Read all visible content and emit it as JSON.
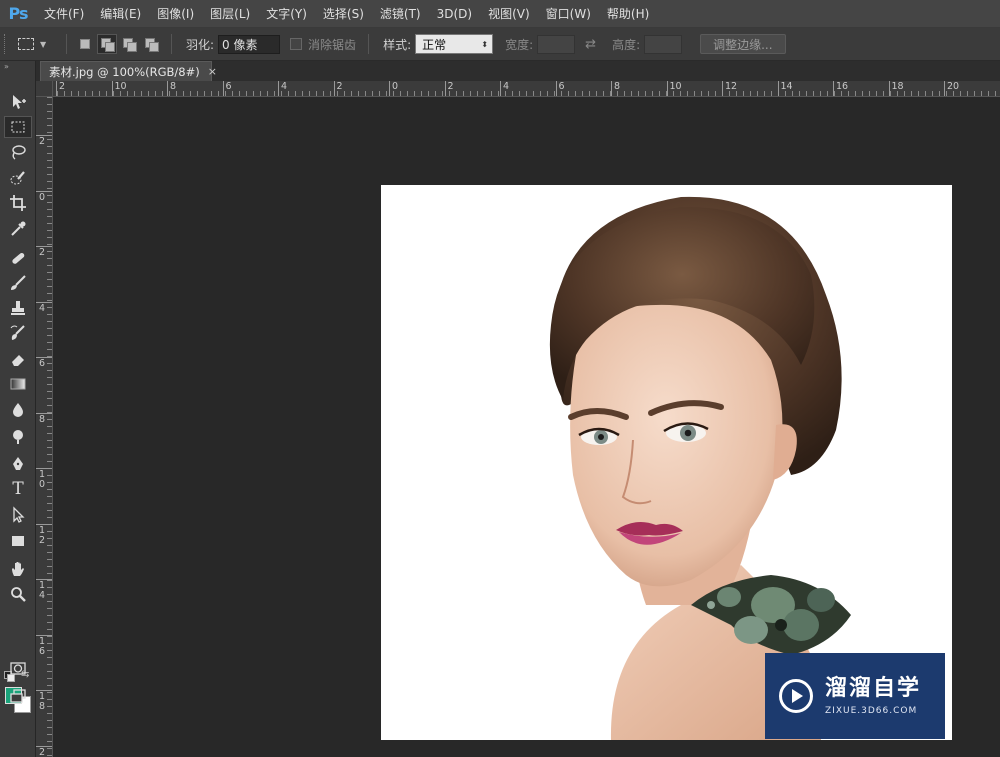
{
  "app": {
    "logo": "Ps"
  },
  "menu": [
    "文件(F)",
    "编辑(E)",
    "图像(I)",
    "图层(L)",
    "文字(Y)",
    "选择(S)",
    "滤镜(T)",
    "3D(D)",
    "视图(V)",
    "窗口(W)",
    "帮助(H)"
  ],
  "options": {
    "feather_label": "羽化:",
    "feather_value": "0 像素",
    "antialias_label": "消除锯齿",
    "style_label": "样式:",
    "style_value": "正常",
    "width_label": "宽度:",
    "height_label": "高度:",
    "refine_edge": "调整边缘..."
  },
  "document": {
    "tab_title": "素材.jpg @ 100%(RGB/8#)",
    "close": "×"
  },
  "ruler_h": [
    "2",
    "10",
    "8",
    "6",
    "4",
    "2",
    "0",
    "2",
    "4",
    "6",
    "8",
    "10",
    "12",
    "14",
    "16",
    "18",
    "20",
    "2"
  ],
  "ruler_v": [
    "2",
    "0",
    "2",
    "4",
    "6",
    "8",
    "1\n0",
    "1\n2",
    "1\n4",
    "1\n6",
    "1\n8",
    "2"
  ],
  "toolbar": {
    "collapse": "»",
    "tools": [
      "move-tool",
      "rect-marquee-tool",
      "lasso-tool",
      "quick-select-tool",
      "crop-tool",
      "eyedropper-tool",
      "healing-brush-tool",
      "brush-tool",
      "clone-stamp-tool",
      "history-brush-tool",
      "eraser-tool",
      "gradient-tool",
      "blur-tool",
      "dodge-tool",
      "pen-tool",
      "type-tool",
      "path-select-tool",
      "rectangle-tool",
      "hand-tool",
      "zoom-tool"
    ],
    "foreground_color": "#1aa37a",
    "background_color": "#ffffff"
  },
  "watermark": {
    "title": "溜溜自学",
    "url": "ZIXUE.3D66.COM"
  }
}
